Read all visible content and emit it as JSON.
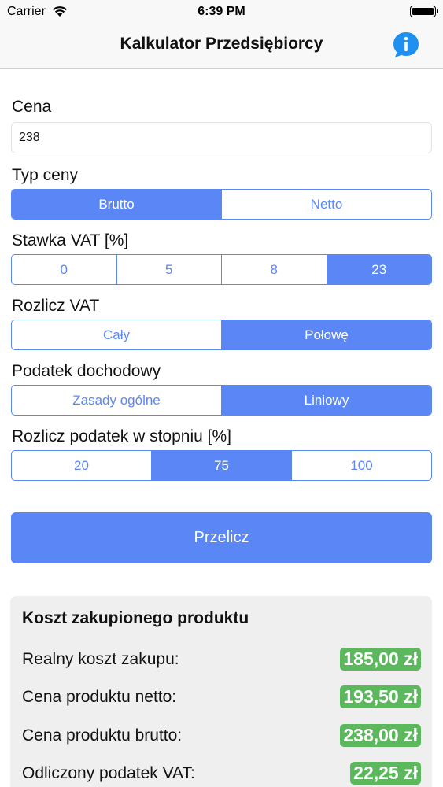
{
  "status_bar": {
    "carrier": "Carrier",
    "time": "6:39 PM"
  },
  "nav": {
    "title": "Kalkulator Przedsiębiorcy",
    "info_icon": "info-icon"
  },
  "form": {
    "price": {
      "label": "Cena",
      "value": "238"
    },
    "price_type": {
      "label": "Typ ceny",
      "options": [
        "Brutto",
        "Netto"
      ],
      "selected": "Brutto"
    },
    "vat_rate": {
      "label": "Stawka VAT [%]",
      "options": [
        "0",
        "5",
        "8",
        "23"
      ],
      "selected": "23"
    },
    "settle_vat": {
      "label": "Rozlicz VAT",
      "options": [
        "Cały",
        "Połowę"
      ],
      "selected": "Połowę"
    },
    "income_tax": {
      "label": "Podatek dochodowy",
      "options": [
        "Zasady ogólne",
        "Liniowy"
      ],
      "selected": "Liniowy"
    },
    "tax_degree": {
      "label": "Rozlicz podatek w stopniu [%]",
      "options": [
        "20",
        "75",
        "100"
      ],
      "selected": "75"
    },
    "calculate_label": "Przelicz"
  },
  "results": {
    "heading": "Koszt zakupionego produktu",
    "rows": [
      {
        "label": "Realny koszt zakupu:",
        "value": "185,00 zł"
      },
      {
        "label": "Cena produktu netto:",
        "value": "193,50 zł"
      },
      {
        "label": "Cena produktu brutto:",
        "value": "238,00 zł"
      },
      {
        "label": "Odliczony podatek VAT:",
        "value": "22,25 zł"
      }
    ]
  },
  "colors": {
    "accent": "#5b86f5",
    "value_badge": "#5cb85c",
    "panel_background": "#efefef"
  }
}
